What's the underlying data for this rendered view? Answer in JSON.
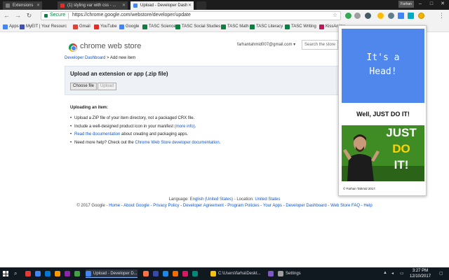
{
  "tabs": [
    {
      "label": "Extensions",
      "favicon_color": "#7a7a7a",
      "active": false
    },
    {
      "label": "(1) styling var with css - ...",
      "favicon_color": "#e52d27",
      "active": false
    },
    {
      "label": "Upload - Developer Dash",
      "favicon_color": "#4285f4",
      "active": true
    }
  ],
  "window": {
    "user_label": "Farhan",
    "minimize": "–",
    "maximize": "□",
    "close": "✕"
  },
  "toolbar": {
    "back": "←",
    "forward": "→",
    "reload": "↻",
    "secure_label": "Secure",
    "url": "https://chrome.google.com/webstore/developer/update",
    "star": "☆",
    "extensions": [
      {
        "name": "ext-green",
        "color": "#34a853"
      },
      {
        "name": "ext-gray",
        "color": "#9e9e9e"
      },
      {
        "name": "ext-dark",
        "color": "#455a64"
      },
      {
        "name": "ext-chrome",
        "color": "#fbbc05"
      },
      {
        "name": "ext-globe",
        "color": "#607d8b"
      },
      {
        "name": "ext-blue",
        "color": "#4285f4"
      },
      {
        "name": "ext-teal",
        "color": "#00acc1"
      },
      {
        "name": "ext-yellow-head",
        "color": "#f4b400"
      }
    ],
    "menu": "⋮"
  },
  "bookmarks": [
    {
      "label": "Apps",
      "color": "#4285f4"
    },
    {
      "label": "MyEIT | Your Resourc",
      "color": "#3f51b5"
    },
    {
      "label": "Gmail",
      "color": "#db4437"
    },
    {
      "label": "YouTube",
      "color": "#e52d27"
    },
    {
      "label": "Google",
      "color": "#4285f4"
    },
    {
      "label": "TASC Science",
      "color": "#0b8043"
    },
    {
      "label": "TASC Social Studies",
      "color": "#0b8043"
    },
    {
      "label": "TASC Math",
      "color": "#0b8043"
    },
    {
      "label": "TASC Literacy",
      "color": "#0b8043"
    },
    {
      "label": "TASC Writing",
      "color": "#0b8043"
    },
    {
      "label": "KissAnime",
      "color": "#c2185b"
    }
  ],
  "page": {
    "store_title": "chrome web store",
    "account": "farhantahmid007@gmail.com ▾",
    "search_placeholder": "Search the store",
    "breadcrumb_link": "Developer Dashboard",
    "breadcrumb_current": " > Add new item",
    "upload_title": "Upload an extension or app (.zip file)",
    "choose_file": "Choose file",
    "upload_button": "Upload",
    "howto_title": "Uploading an item:",
    "howto": [
      {
        "pre": "Upload a ZIP file of your item directory, not a packaged CRX file.",
        "link": "",
        "post": ""
      },
      {
        "pre": "Include a well-designed product icon in your manifest ",
        "link": "(more info)",
        "post": "."
      },
      {
        "pre": "",
        "link": "Read the documentation",
        "post": " about creating and packaging apps."
      },
      {
        "pre": "Need more help? Check out the ",
        "link": "Chrome Web Store developer documentation",
        "post": "."
      }
    ],
    "footer": {
      "language_label": "Language: ",
      "language": "English (United States)",
      "location_label": " - Location: ",
      "location": "United States",
      "copyright": "© 2017 Google - ",
      "links": [
        "Home",
        "About Google",
        "Privacy Policy",
        "Developer Agreement",
        "Program Policies",
        "Your Apps",
        "Developer Dashboard",
        "Web Store FAQ",
        "Help"
      ]
    }
  },
  "popup": {
    "head_line1": "It's a",
    "head_line2": "Head!",
    "title": "Well, JUST DO IT!",
    "image_words": [
      "JUST",
      "DO",
      "IT!"
    ],
    "credit": "© Farhan Tahmid 2017.",
    "accent": "#4f87ec"
  },
  "taskbar": {
    "search_icon": "⌕",
    "items": [
      {
        "label": "Upload - Developer D...",
        "color": "#4285f4",
        "active": true
      },
      {
        "label": "C:\\Users\\farha\\Deskt...",
        "color": "#f4c20d",
        "active": false
      },
      {
        "label": "Settings",
        "color": "#9e9e9e",
        "active": false
      }
    ],
    "pinned": [
      "#e53935",
      "#4285f4",
      "#0078d7",
      "#ff9800",
      "#8e24aa",
      "#43a047",
      "#3949ab"
    ],
    "time": "3:27 PM",
    "date": "12/10/2017"
  }
}
